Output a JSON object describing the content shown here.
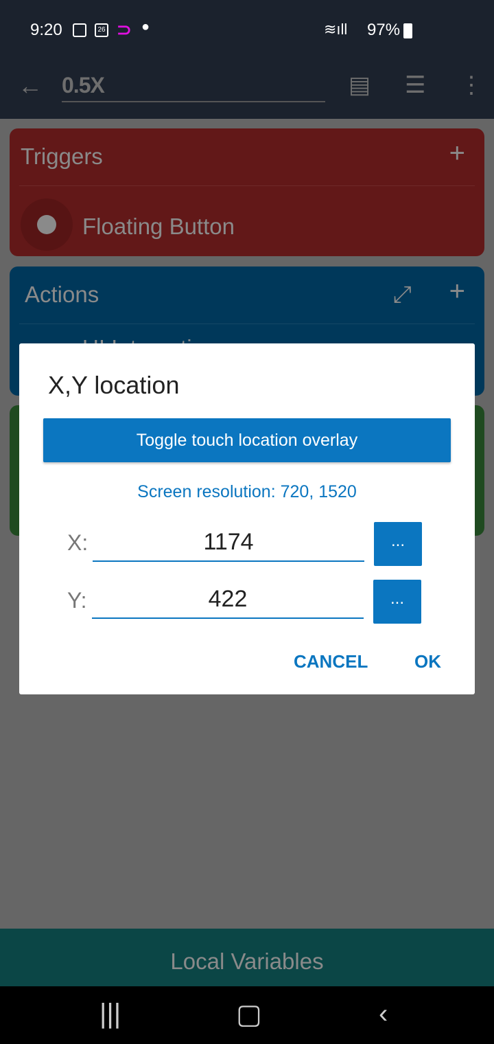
{
  "status_bar": {
    "time": "9:20",
    "calendar_day": "26",
    "battery": "97%"
  },
  "app_bar": {
    "title": "0.5X",
    "icons": [
      "arrow-back-icon",
      "document-icon",
      "list-icon",
      "more-vert-icon"
    ]
  },
  "triggers": {
    "header": "Triggers",
    "items": [
      {
        "label": "Floating Button"
      }
    ],
    "color": "#621818"
  },
  "actions": {
    "header": "Actions",
    "items": [
      {
        "label": "UI Interaction"
      }
    ],
    "color": "#00385a"
  },
  "dialog": {
    "title": "X,Y location",
    "toggle_button": "Toggle touch location overlay",
    "resolution": "Screen resolution: 720, 1520",
    "x_label": "X:",
    "x_value": "1174",
    "y_label": "Y:",
    "y_value": "422",
    "picker_label": "...",
    "cancel": "CANCEL",
    "ok": "OK",
    "accent": "#0b76c0"
  },
  "bottom_bar": {
    "label": "Local Variables"
  }
}
